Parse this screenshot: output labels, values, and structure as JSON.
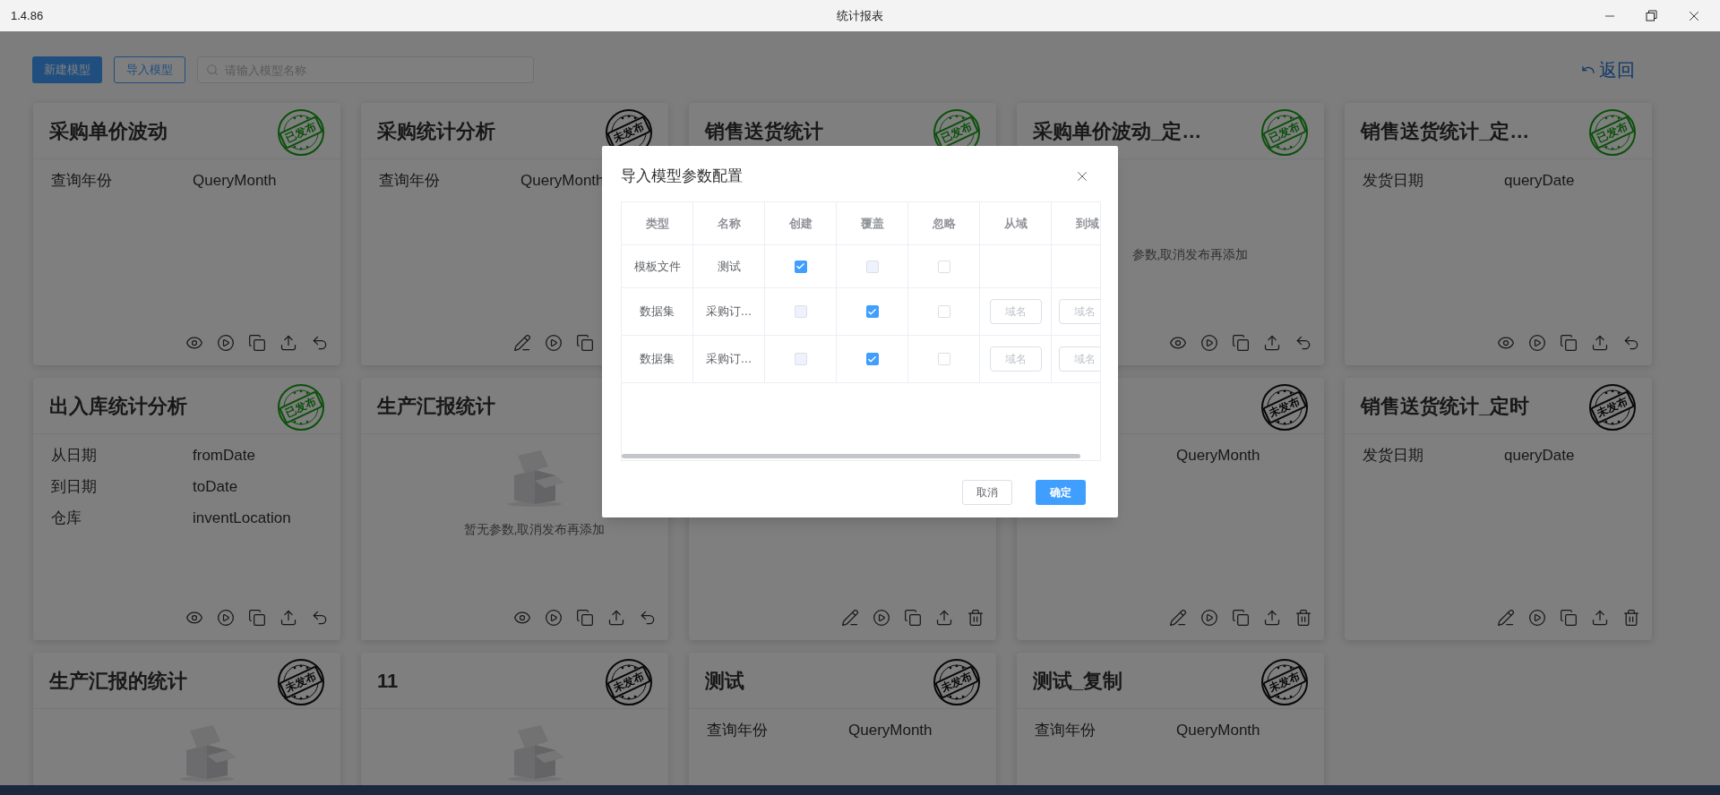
{
  "app_bar": {
    "version": "1.4.86",
    "title": "统计报表"
  },
  "toolbar": {
    "new_button": "新建模型",
    "import_button": "导入模型",
    "search": {
      "placeholder": "请输入模型名称"
    },
    "back_link": "返回"
  },
  "cards": [
    {
      "title": "采购单价波动",
      "stamp": {
        "kind": "published",
        "text": "已发布"
      },
      "params": [
        {
          "label": "查询年份",
          "value": "QueryMonth"
        }
      ],
      "actions": [
        {
          "kind": "view"
        },
        {
          "kind": "run"
        },
        {
          "kind": "copy"
        },
        {
          "kind": "export"
        },
        {
          "kind": "revoke"
        }
      ]
    },
    {
      "title": "采购统计分析",
      "stamp": {
        "kind": "unpublished",
        "text": "未发布"
      },
      "params": [
        {
          "label": "查询年份",
          "value": "QueryMonth"
        }
      ],
      "actions": [
        {
          "kind": "edit"
        },
        {
          "kind": "run"
        },
        {
          "kind": "copy"
        }
      ]
    },
    {
      "title": "销售送货统计",
      "stamp": {
        "kind": "published",
        "text": "已发布"
      }
    },
    {
      "title": "采购单价波动_定…",
      "stamp": {
        "kind": "published",
        "text": "已发布"
      },
      "empty_text": "参数,取消发布再添加",
      "actions": [
        {
          "kind": "view"
        },
        {
          "kind": "run"
        },
        {
          "kind": "copy"
        },
        {
          "kind": "export"
        },
        {
          "kind": "revoke"
        }
      ]
    },
    {
      "title": "销售送货统计_定…",
      "stamp": {
        "kind": "published",
        "text": "已发布"
      },
      "params": [
        {
          "label": "发货日期",
          "value": "queryDate"
        }
      ],
      "actions": [
        {
          "kind": "view"
        },
        {
          "kind": "run"
        },
        {
          "kind": "copy"
        },
        {
          "kind": "export"
        },
        {
          "kind": "revoke"
        }
      ]
    },
    {
      "title": "出入库统计分析",
      "stamp": {
        "kind": "published",
        "text": "已发布"
      },
      "params": [
        {
          "label": "从日期",
          "value": "fromDate"
        },
        {
          "label": "到日期",
          "value": "toDate"
        },
        {
          "label": "仓库",
          "value": "inventLocation"
        }
      ],
      "actions": [
        {
          "kind": "view"
        },
        {
          "kind": "run"
        },
        {
          "kind": "copy"
        },
        {
          "kind": "export"
        },
        {
          "kind": "revoke"
        }
      ]
    },
    {
      "title": "生产汇报统计",
      "empty": true,
      "empty_text": "暂无参数,取消发布再添加",
      "actions": [
        {
          "kind": "view"
        },
        {
          "kind": "run"
        },
        {
          "kind": "copy"
        },
        {
          "kind": "export"
        },
        {
          "kind": "revoke"
        }
      ]
    },
    {
      "actions": [
        {
          "kind": "edit"
        },
        {
          "kind": "run"
        },
        {
          "kind": "copy"
        },
        {
          "kind": "export"
        },
        {
          "kind": "delete"
        }
      ]
    },
    {
      "stamp": {
        "kind": "unpublished",
        "text": "未发布"
      },
      "params": [
        {
          "value": "QueryMonth"
        }
      ],
      "actions": [
        {
          "kind": "edit"
        },
        {
          "kind": "run"
        },
        {
          "kind": "copy"
        },
        {
          "kind": "export"
        },
        {
          "kind": "delete"
        }
      ]
    },
    {
      "title": "销售送货统计_定时",
      "stamp": {
        "kind": "unpublished",
        "text": "未发布"
      },
      "params": [
        {
          "label": "发货日期",
          "value": "queryDate"
        }
      ],
      "actions": [
        {
          "kind": "edit"
        },
        {
          "kind": "run"
        },
        {
          "kind": "copy"
        },
        {
          "kind": "export"
        },
        {
          "kind": "delete"
        }
      ]
    },
    {
      "title": "生产汇报的统计",
      "stamp": {
        "kind": "unpublished",
        "text": "未发布"
      },
      "empty": true
    },
    {
      "title": "11",
      "stamp": {
        "kind": "unpublished",
        "text": "未发布"
      },
      "empty": true
    },
    {
      "title": "测试",
      "stamp": {
        "kind": "unpublished",
        "text": "未发布"
      },
      "params": [
        {
          "label": "查询年份",
          "value": "QueryMonth"
        }
      ]
    },
    {
      "title": "测试_复制",
      "stamp": {
        "kind": "unpublished",
        "text": "未发布"
      },
      "params": [
        {
          "label": "查询年份",
          "value": "QueryMonth"
        }
      ]
    }
  ],
  "dialog": {
    "title": "导入模型参数配置",
    "columns": [
      "类型",
      "名称",
      "创建",
      "覆盖",
      "忽略",
      "从域",
      "到域"
    ],
    "rows": [
      {
        "type": "模板文件",
        "name": "测试",
        "create": {
          "checked": true,
          "disabled": false
        },
        "overwrite": {
          "checked": false,
          "disabled": true
        },
        "ignore": {
          "checked": false,
          "disabled": false
        }
      },
      {
        "type": "数据集",
        "name": "采购订…",
        "create": {
          "checked": false,
          "disabled": true
        },
        "overwrite": {
          "checked": true,
          "disabled": false
        },
        "ignore": {
          "checked": false,
          "disabled": false
        },
        "from_domain": {
          "placeholder": "域名"
        },
        "to_domain": {
          "placeholder": "域名"
        }
      },
      {
        "type": "数据集",
        "name": "采购订…",
        "create": {
          "checked": false,
          "disabled": true
        },
        "overwrite": {
          "checked": true,
          "disabled": false
        },
        "ignore": {
          "checked": false,
          "disabled": false
        },
        "from_domain": {
          "placeholder": "域名"
        },
        "to_domain": {
          "placeholder": "域名"
        }
      }
    ],
    "cancel_button": "取消",
    "confirm_button": "确定"
  }
}
